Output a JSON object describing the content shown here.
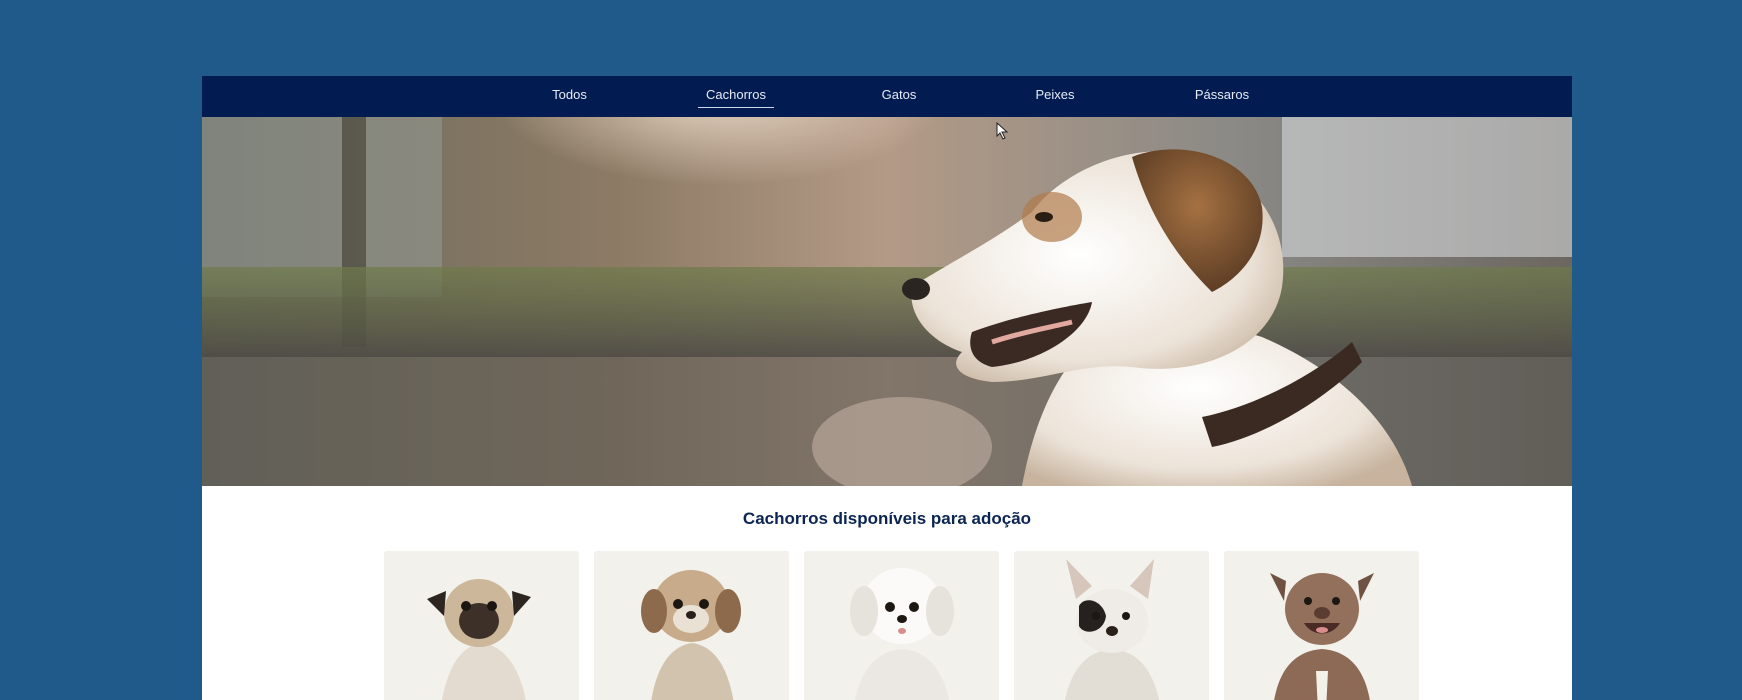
{
  "nav": {
    "items": [
      {
        "label": "Todos",
        "active": false
      },
      {
        "label": "Cachorros",
        "active": true
      },
      {
        "label": "Gatos",
        "active": false
      },
      {
        "label": "Peixes",
        "active": false
      },
      {
        "label": "Pássaros",
        "active": false
      }
    ]
  },
  "hero": {
    "image": "dog-profile-sunset-photo"
  },
  "section": {
    "title": "Cachorros disponíveis para adoção"
  },
  "cards": [
    {
      "image": "pug-photo",
      "breed": "pug"
    },
    {
      "image": "shih-tzu-photo",
      "breed": "shih tzu"
    },
    {
      "image": "maltese-photo",
      "breed": "maltese"
    },
    {
      "image": "french-bulldog-photo",
      "breed": "french bulldog"
    },
    {
      "image": "pit-bull-photo",
      "breed": "pit bull"
    }
  ],
  "colors": {
    "background": "#1f5a8b",
    "nav": "#021c51",
    "title": "#0b2552",
    "card": "#f3f1ec"
  }
}
